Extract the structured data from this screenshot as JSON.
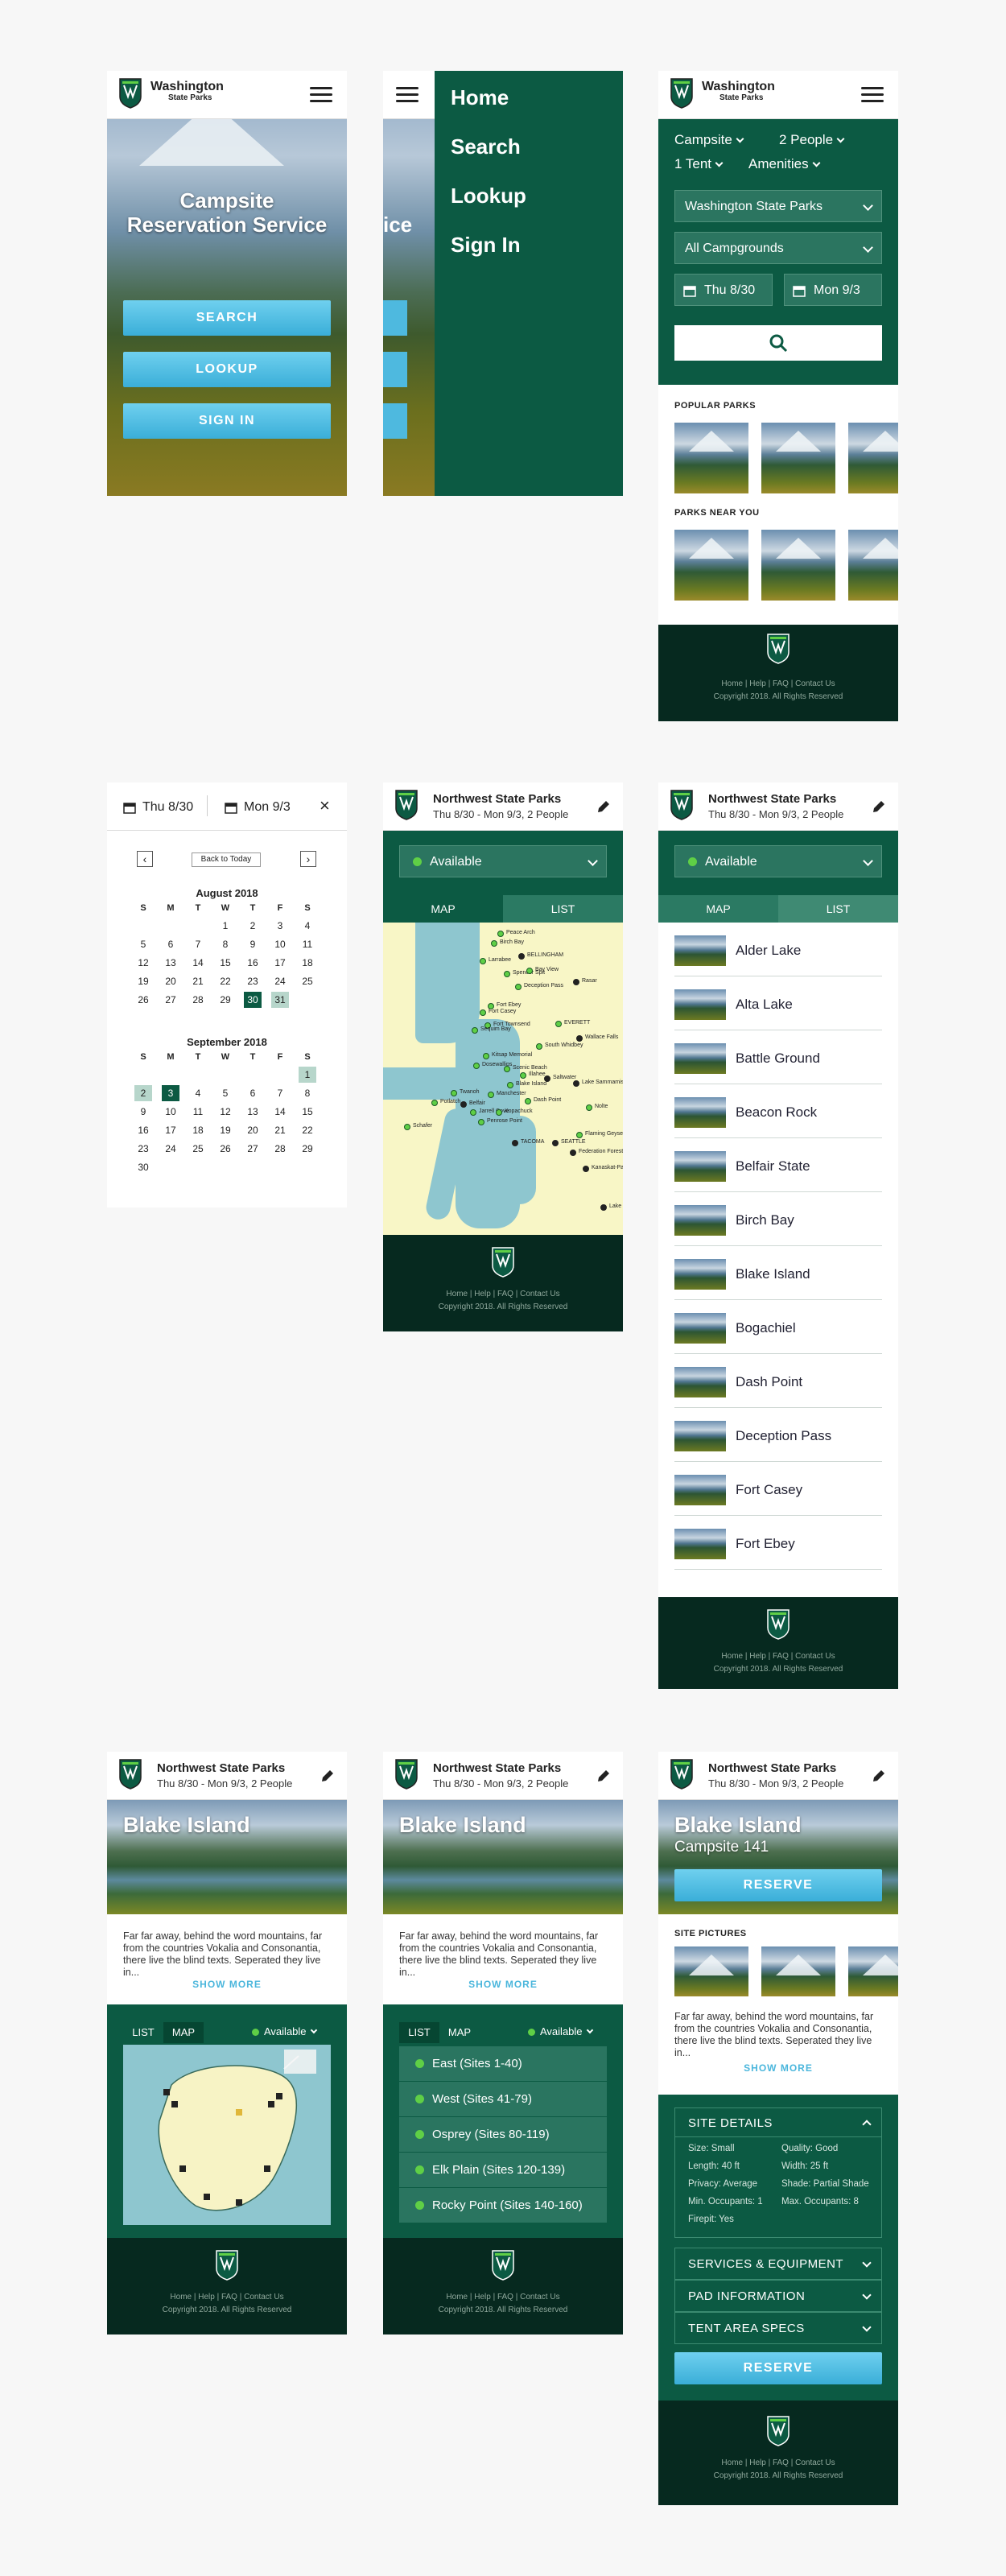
{
  "brand": {
    "name": "Washington",
    "sub": "State Parks",
    "colors": {
      "green": "#0c5a43",
      "dark": "#06291f",
      "blue": "#3aaed8",
      "avail": "#5fcf46"
    }
  },
  "s1": {
    "title": "Campsite Reservation Service",
    "buttons": [
      "SEARCH",
      "LOOKUP",
      "SIGN IN"
    ]
  },
  "s2": {
    "menu": [
      "Home",
      "Search",
      "Lookup",
      "Sign In"
    ],
    "peek": "ice"
  },
  "s3": {
    "opts": [
      "Campsite",
      "2 People",
      "1 Tent",
      "Amenities"
    ],
    "park_select": "Washington State Parks",
    "camp_select": "All Campgrounds",
    "date_in": "Thu 8/30",
    "date_out": "Mon 9/3",
    "popular": "POPULAR PARKS",
    "near": "PARKS NEAR YOU"
  },
  "footer": {
    "links": "Home | Help | FAQ | Contact Us",
    "copy": "Copyright 2018. All Rights Reserved"
  },
  "cal": {
    "date_in": "Thu 8/30",
    "date_out": "Mon 9/3",
    "close": "×",
    "today": "Back to Today",
    "weekdays": [
      "S",
      "M",
      "T",
      "W",
      "T",
      "F",
      "S"
    ],
    "aug": {
      "title": "August 2018",
      "days": [
        "1",
        "2",
        "3",
        "4",
        "5",
        "6",
        "7",
        "8",
        "9",
        "10",
        "11",
        "12",
        "13",
        "14",
        "15",
        "16",
        "17",
        "18",
        "19",
        "20",
        "21",
        "22",
        "23",
        "24",
        "25",
        "26",
        "27",
        "28",
        "29",
        "30",
        "31"
      ]
    },
    "sep": {
      "title": "September 2018",
      "days": [
        "1",
        "2",
        "3",
        "4",
        "5",
        "6",
        "7",
        "8",
        "9",
        "10",
        "11",
        "12",
        "13",
        "14",
        "15",
        "16",
        "17",
        "18",
        "19",
        "20",
        "21",
        "22",
        "23",
        "24",
        "25",
        "26",
        "27",
        "28",
        "29",
        "30"
      ]
    }
  },
  "park": {
    "title": "Northwest State Parks",
    "sub": "Thu 8/30 - Mon 9/3, 2 People",
    "avail": "Available",
    "tab_map": "MAP",
    "tab_list": "LIST"
  },
  "map_labels": [
    "Peace Arch",
    "Birch Bay",
    "BELLINGHAM",
    "Larrabee",
    "Spencer Spit",
    "Bay View",
    "Rasar",
    "Deception Pass",
    "Fort Ebey",
    "Fort Casey",
    "Fort Townsend",
    "Sequim Bay",
    "EVERETT",
    "Wallace Falls",
    "South Whidbey",
    "Kitsap Memorial",
    "Dosewallips",
    "Scenic Beach",
    "Illahee",
    "Lake Sammamish",
    "Blake Island",
    "Saltwater",
    "Dash Point",
    "Manchester",
    "Potlatch",
    "Jarrell Cove",
    "Penrose Point",
    "Kopachuck",
    "Schafer",
    "TACOMA",
    "SEATTLE",
    "Flaming Geyser",
    "Federation Forest",
    "Nolte",
    "Kanaskat-Palmer",
    "Twanoh",
    "Belfair",
    "Lake"
  ],
  "parks": [
    "Alder Lake",
    "Alta Lake",
    "Battle Ground",
    "Beacon Rock",
    "Belfair State",
    "Birch Bay",
    "Blake Island",
    "Bogachiel",
    "Dash Point",
    "Deception Pass",
    "Fort Casey",
    "Fort Ebey"
  ],
  "blake": {
    "title": "Blake Island",
    "para": "Far far away, behind the word mountains, far from the countries Vokalia and Consonantia, there live the blind texts. Seperated they live in...",
    "more": "SHOW MORE",
    "tab_list": "LIST",
    "tab_map": "MAP",
    "avail": "Available",
    "areas": [
      "East (Sites 1-40)",
      "West (Sites 41-79)",
      "Osprey (Sites 80-119)",
      "Elk Plain (Sites 120-139)",
      "Rocky Point (Sites 140-160)"
    ]
  },
  "site": {
    "title": "Blake Island",
    "sub": "Campsite 141",
    "reserve": "RESERVE",
    "pics": "SITE PICTURES",
    "details": "SITE DETAILS",
    "specs": [
      [
        "Size: Small",
        "Quality: Good"
      ],
      [
        "Length: 40 ft",
        "Width: 25 ft"
      ],
      [
        "Privacy: Average",
        "Shade: Partial Shade"
      ],
      [
        "Min. Occupants: 1",
        "Max. Occupants: 8"
      ],
      [
        "Firepit: Yes",
        ""
      ]
    ],
    "sections": [
      "SERVICES & EQUIPMENT",
      "PAD INFORMATION",
      "TENT AREA SPECS"
    ]
  }
}
